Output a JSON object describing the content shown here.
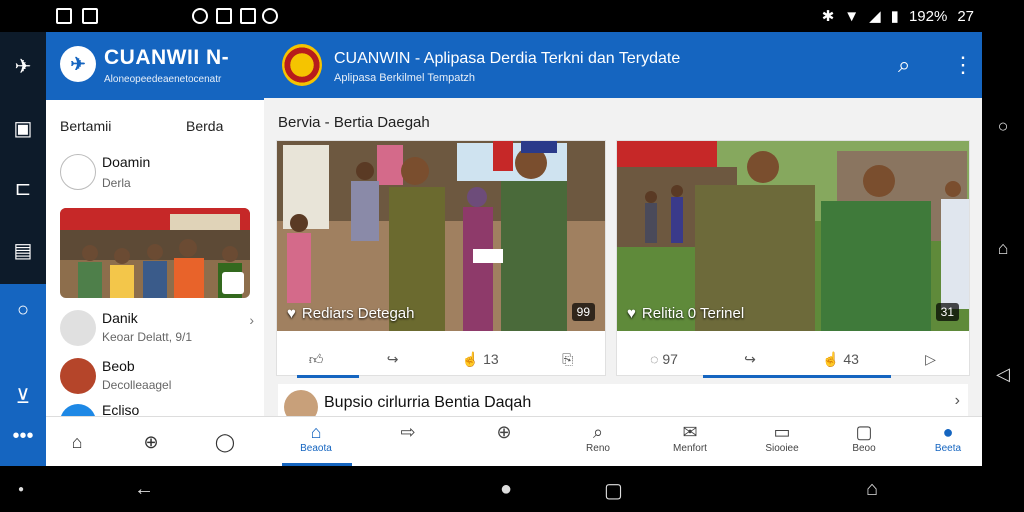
{
  "status_bar": {
    "battery": "192%",
    "time": "27"
  },
  "panel": {
    "title": "CUANWII N-",
    "subtitle": "Aloneopeedeaenetocenatr",
    "tabs": [
      "Bertamii",
      "Berda"
    ],
    "chats": [
      {
        "name": "Doamin",
        "sub": "Derla"
      },
      {
        "name": "Danik",
        "sub": "Keoar Delatt, 9/1"
      },
      {
        "name": "Beob",
        "sub": "Decolleaagel"
      },
      {
        "name": "Ecliso",
        "sub": ""
      }
    ]
  },
  "main": {
    "title": "CUANWIN - Aplipasa Derdia Terkni dan Terydate",
    "subtitle": "Aplipasa Berkilmel Tempatzh",
    "section": "Bervia - Bertia Daegah",
    "cards": [
      {
        "caption": "Rediars Detegah",
        "badge": "99",
        "actions": [
          "",
          "",
          "13",
          ""
        ]
      },
      {
        "caption": "Relitia 0 Terinel",
        "badge": "31",
        "actions": [
          "97",
          "",
          "43",
          ""
        ]
      }
    ],
    "list_title": "Bupsio cirlurria Bentia Daqah",
    "bottom_nav": [
      "Beaota",
      "",
      "",
      "Reno",
      "Menfort",
      "Siooiee",
      "Beoo",
      "Beeta"
    ]
  },
  "colors": {
    "primary": "#1565c0",
    "rail": "#0d1b2a"
  }
}
